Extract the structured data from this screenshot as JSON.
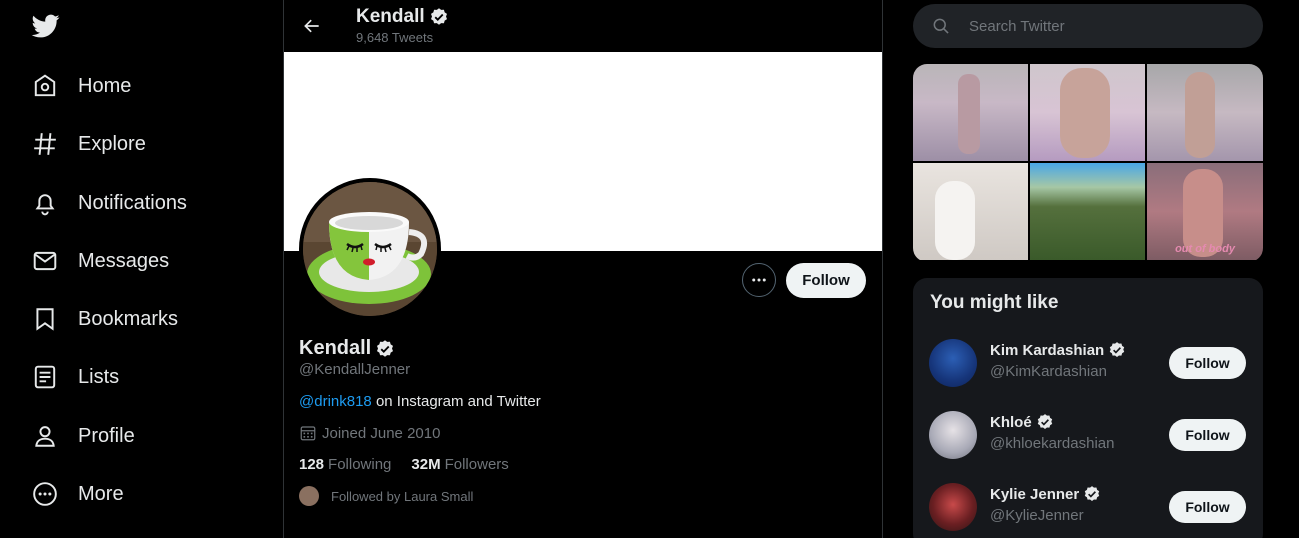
{
  "nav": {
    "items": [
      {
        "label": "Home",
        "icon": "home-icon"
      },
      {
        "label": "Explore",
        "icon": "hashtag-icon"
      },
      {
        "label": "Notifications",
        "icon": "bell-icon"
      },
      {
        "label": "Messages",
        "icon": "envelope-icon"
      },
      {
        "label": "Bookmarks",
        "icon": "bookmark-icon"
      },
      {
        "label": "Lists",
        "icon": "list-icon"
      },
      {
        "label": "Profile",
        "icon": "person-icon"
      },
      {
        "label": "More",
        "icon": "more-circle-icon"
      }
    ]
  },
  "header": {
    "name": "Kendall",
    "tweet_count": "9,648 Tweets"
  },
  "profile": {
    "name": "Kendall",
    "handle": "@KendallJenner",
    "bio_link": "@drink818",
    "bio_rest": " on Instagram and Twitter",
    "joined": "Joined June 2010",
    "following_count": "128",
    "following_label": "Following",
    "followers_count": "32M",
    "followers_label": "Followers",
    "followed_by": "Followed by Laura Small",
    "follow_label": "Follow"
  },
  "search": {
    "placeholder": "Search Twitter"
  },
  "media": {
    "overlay_text": "out of body"
  },
  "who_to_follow": {
    "title": "You might like",
    "accounts": [
      {
        "name": "Kim Kardashian",
        "handle": "@KimKardashian",
        "button": "Follow"
      },
      {
        "name": "Khloé",
        "handle": "@khloekardashian",
        "button": "Follow"
      },
      {
        "name": "Kylie Jenner",
        "handle": "@KylieJenner",
        "button": "Follow"
      }
    ]
  },
  "colors": {
    "accent": "#1d9bf0",
    "background": "#000000",
    "panel": "#16181c",
    "muted_text": "#71767b"
  }
}
